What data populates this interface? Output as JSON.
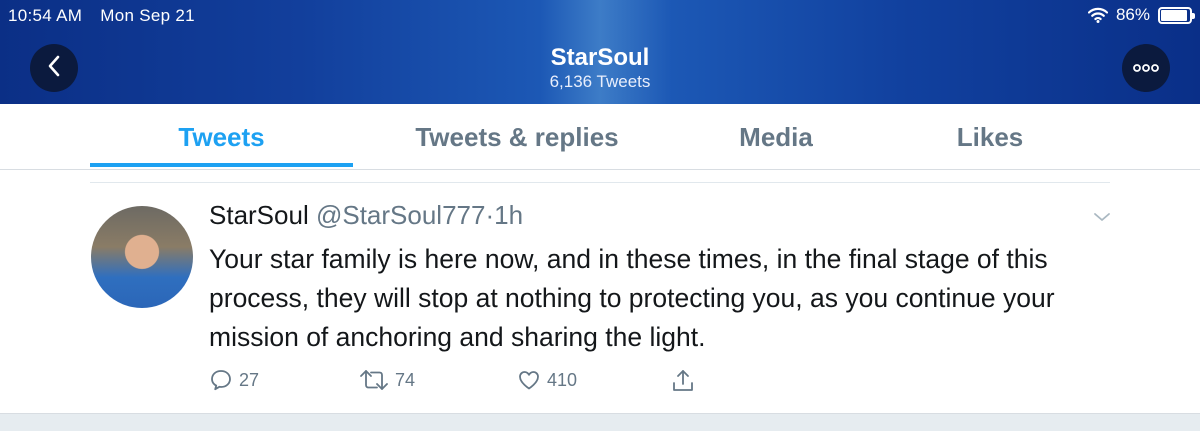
{
  "status_bar": {
    "time": "10:54 AM",
    "date": "Mon Sep 21",
    "battery": "86%",
    "battery_level": 0.86
  },
  "header": {
    "title": "StarSoul",
    "subtitle": "6,136 Tweets"
  },
  "tabs": [
    {
      "label": "Tweets",
      "active": true
    },
    {
      "label": "Tweets & replies",
      "active": false
    },
    {
      "label": "Media",
      "active": false
    },
    {
      "label": "Likes",
      "active": false
    }
  ],
  "tweet": {
    "name": "StarSoul",
    "handle": "@StarSoul777",
    "separator": "·",
    "time": "1h",
    "text": "Your star family is here now, and in these times, in the final stage of this process, they will stop at nothing to protecting you, as you continue your mission of anchoring and sharing the light.",
    "replies": "27",
    "retweets": "74",
    "likes": "410"
  },
  "icons": {
    "back": "chevron-left-icon",
    "more": "more-dots-icon",
    "wifi": "wifi-icon",
    "battery": "battery-icon",
    "caret": "chevron-down-icon",
    "reply": "reply-icon",
    "retweet": "retweet-icon",
    "like": "heart-icon",
    "share": "share-icon"
  },
  "colors": {
    "accent": "#1da1f2",
    "header": "#123f9c",
    "muted": "#657786",
    "text": "#14171a"
  }
}
